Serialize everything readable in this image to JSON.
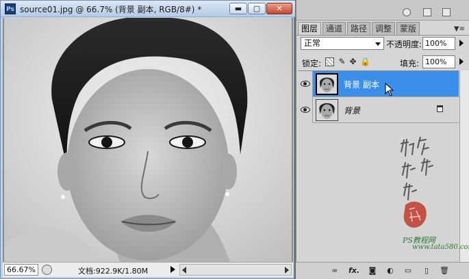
{
  "document": {
    "app_icon": "Ps",
    "title": "source01.jpg @ 66.7% (背景 副本, RGB/8#) *",
    "minimize_label": "▬",
    "maximize_label": "▢",
    "close_label": "✕",
    "zoom": "66.67%",
    "doc_info": "文档:922.9K/1.80M"
  },
  "panel": {
    "tabs": [
      {
        "label": "图层",
        "active": true
      },
      {
        "label": "通道",
        "active": false
      },
      {
        "label": "路径",
        "active": false
      },
      {
        "label": "调整",
        "active": false
      },
      {
        "label": "蒙版",
        "active": false
      }
    ],
    "menu_icon": "▼≡",
    "blend_mode": "正常",
    "opacity_label": "不透明度:",
    "opacity_value": "100%",
    "lock_label": "锁定:",
    "fill_label": "填充:",
    "fill_value": "100%",
    "layers": [
      {
        "name": "背景 副本",
        "selected": true,
        "visible": true,
        "locked": false
      },
      {
        "name": "背景",
        "selected": false,
        "visible": true,
        "locked": true
      }
    ]
  },
  "watermark": {
    "text": "PS教程网",
    "url": "www.tata580.com"
  },
  "icons": {
    "lock_brush": "✎",
    "lock_move": "✥",
    "lock_all": "🔒",
    "link": "∞",
    "fx": "fx.",
    "mask": "◙",
    "adjust": "◐",
    "folder": "▭",
    "new_layer": "▯",
    "trash": "🗑"
  },
  "colors": {
    "selection_blue": "#3b8fe8",
    "close_red": "#c3472c"
  }
}
